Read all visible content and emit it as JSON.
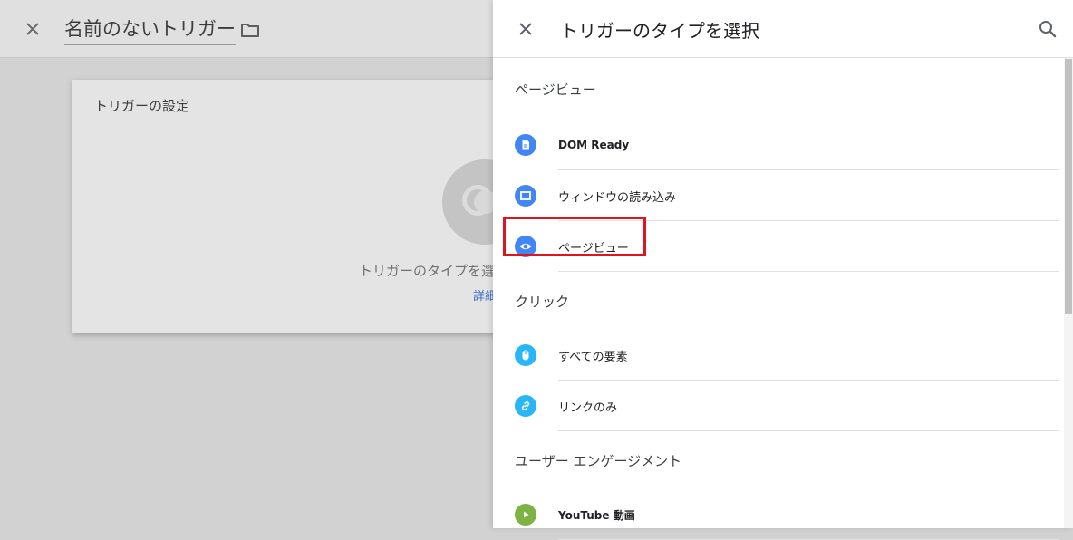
{
  "background": {
    "trigger_name": "名前のないトリガー",
    "card_title": "トリガーの設定",
    "prompt": "トリガーのタイプを選",
    "link": "詳細"
  },
  "panel": {
    "title": "トリガーのタイプを選択",
    "sections": [
      {
        "heading": "ページビュー",
        "items": [
          {
            "label": "DOM Ready",
            "icon": "document-icon",
            "color": "#4285f4"
          },
          {
            "label": "ウィンドウの読み込み",
            "icon": "window-icon",
            "color": "#4285f4"
          },
          {
            "label": "ページビュー",
            "icon": "eye-icon",
            "color": "#4285f4"
          }
        ]
      },
      {
        "heading": "クリック",
        "items": [
          {
            "label": "すべての要素",
            "icon": "mouse-icon",
            "color": "#29b6f6"
          },
          {
            "label": "リンクのみ",
            "icon": "link-icon",
            "color": "#29b6f6"
          }
        ]
      },
      {
        "heading": "ユーザー エンゲージメント",
        "items": [
          {
            "label": "YouTube 動画",
            "icon": "play-icon",
            "color": "#7cb342"
          }
        ]
      }
    ]
  },
  "colors": {
    "highlight": "#e0141e",
    "page_view_icon": "#4285f4",
    "click_icon": "#29b6f6",
    "engagement_icon": "#7cb342"
  }
}
